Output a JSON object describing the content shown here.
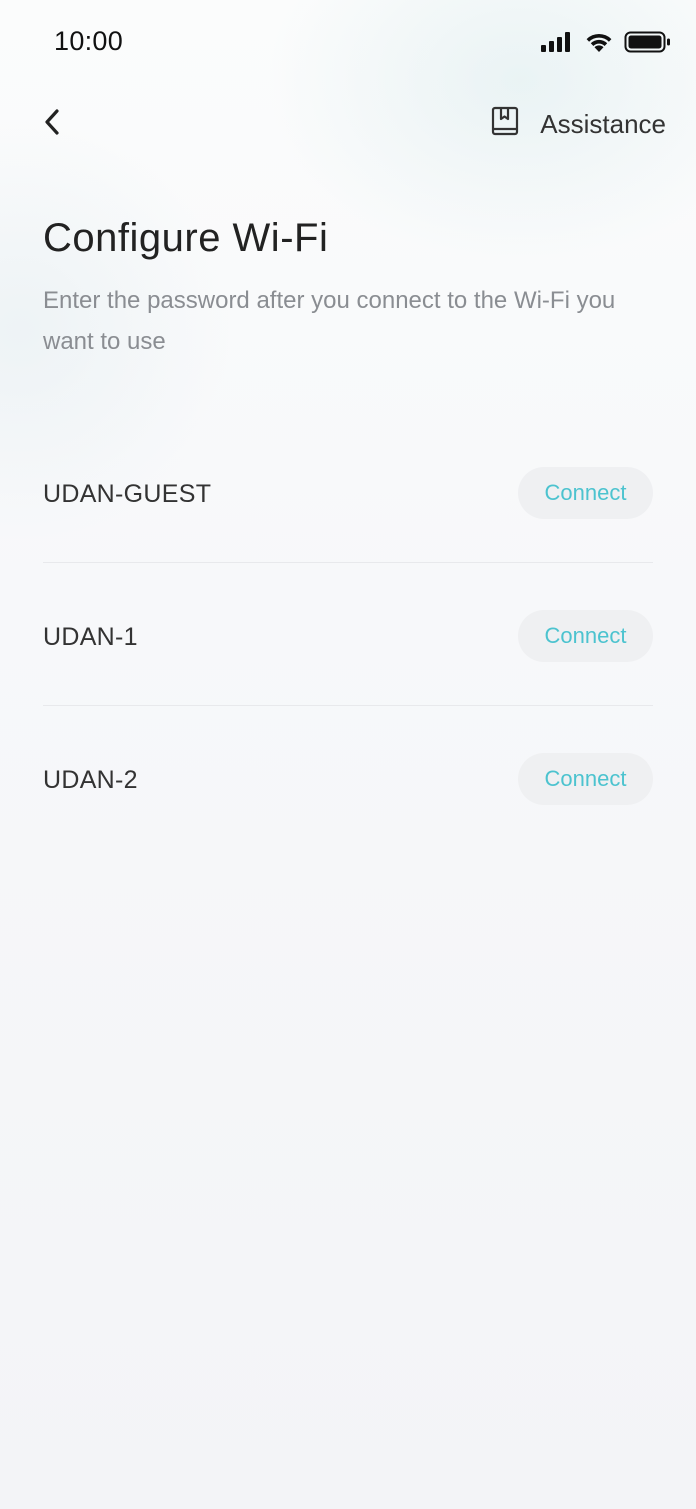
{
  "status_bar": {
    "time": "10:00",
    "icons": [
      "signal-icon",
      "wifi-icon",
      "battery-icon"
    ]
  },
  "nav": {
    "back_icon": "chevron-left-icon",
    "assist_icon": "book-icon",
    "assistance_label": "Assistance"
  },
  "page": {
    "title": "Configure Wi-Fi",
    "subtitle": "Enter the password after you connect to the Wi-Fi you want to use"
  },
  "networks": [
    {
      "ssid": "UDAN-GUEST",
      "action": "Connect"
    },
    {
      "ssid": "UDAN-1",
      "action": "Connect"
    },
    {
      "ssid": "UDAN-2",
      "action": "Connect"
    }
  ],
  "colors": {
    "accent": "#4cc3cf",
    "button_bg": "#eff0f2",
    "subtitle": "#8a8d92"
  }
}
